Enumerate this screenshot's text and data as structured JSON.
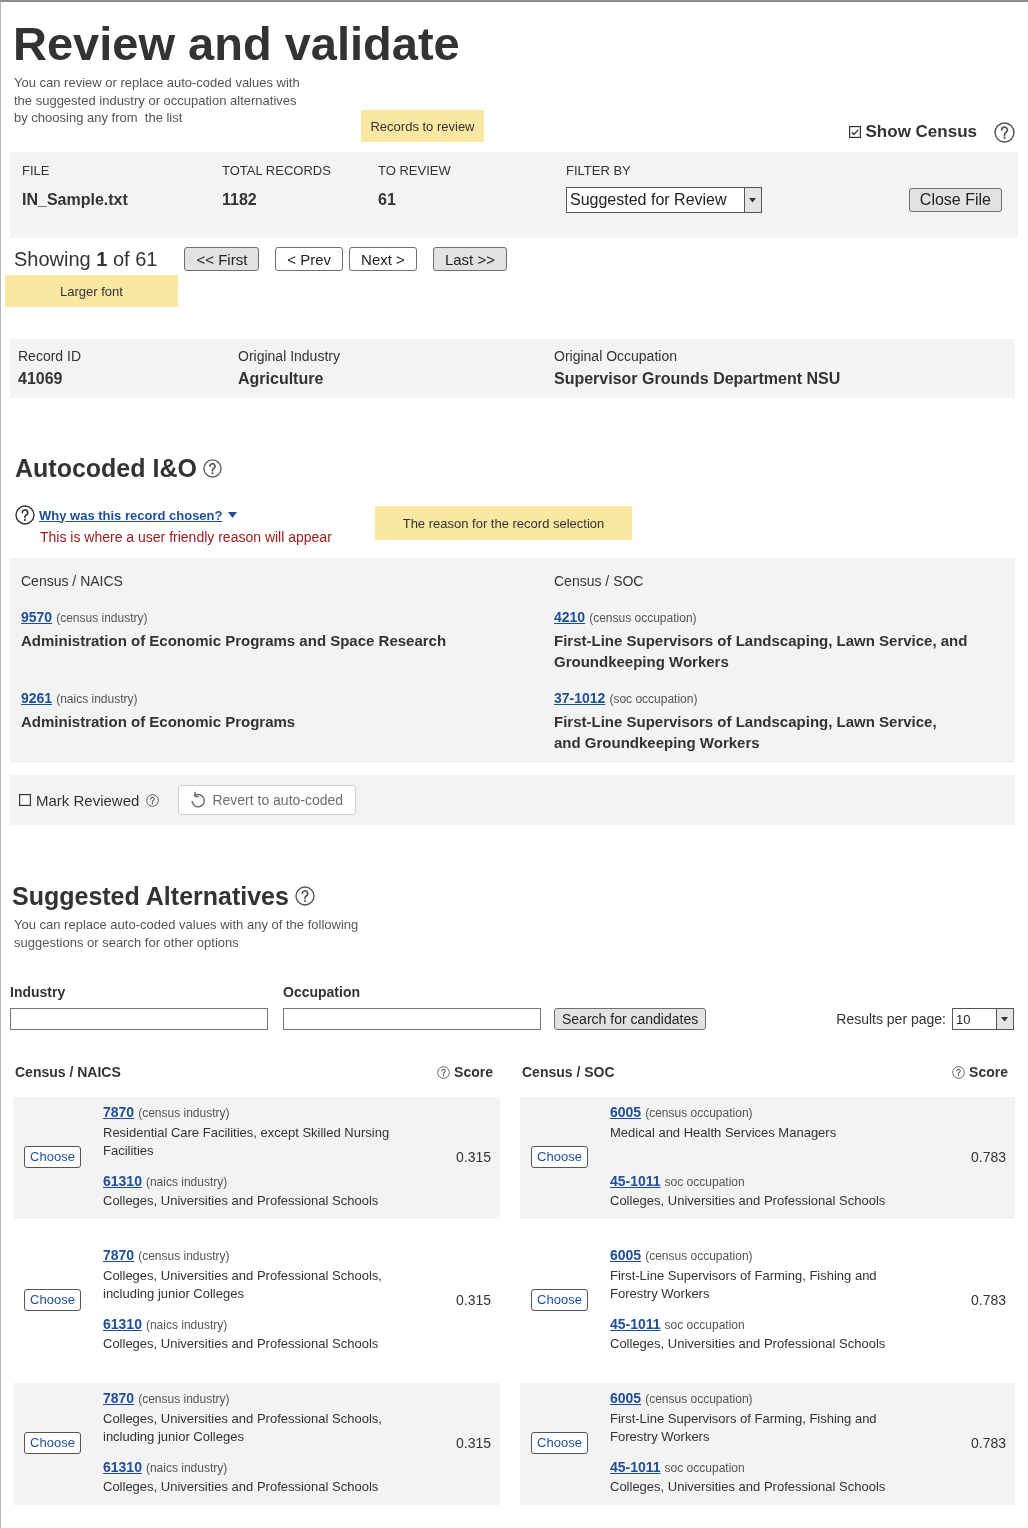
{
  "header": {
    "title": "Review and validate",
    "description": "You can review or replace auto-coded values with\nthe suggested industry or occupation alternatives\nby choosing any from  the list",
    "note": "Records to review",
    "show_census": {
      "label": "Show Census",
      "checked": true
    }
  },
  "file_panel": {
    "fields": [
      {
        "label": "FILE",
        "value": "IN_Sample.txt"
      },
      {
        "label": "TOTAL RECORDS",
        "value": "1182"
      },
      {
        "label": "TO REVIEW",
        "value": "61"
      }
    ],
    "filter": {
      "label": "FILTER BY",
      "value": "Suggested for Review"
    },
    "close_button": "Close File"
  },
  "pager": {
    "showing": "Showing **1** of 61",
    "buttons": [
      {
        "label": "<< First",
        "kind": "jump"
      },
      {
        "label": "< Prev",
        "kind": "step"
      },
      {
        "label": "Next >",
        "kind": "step"
      },
      {
        "label": "Last >>",
        "kind": "jump"
      }
    ],
    "note": "Larger font"
  },
  "record": {
    "fields": [
      {
        "label": "Record ID",
        "value": "41069"
      },
      {
        "label": "Original Industry",
        "value": "Agriculture"
      },
      {
        "label": "Original Occupation",
        "value": "Supervisor Grounds Department NSU"
      }
    ]
  },
  "autocoded": {
    "title": "Autocoded I&O",
    "reason_link": "Why was this record chosen?",
    "reason_text": "This is where a user friendly reason will appear",
    "note": "The reason for the record selection",
    "columns": [
      {
        "heading": "Census / NAICS",
        "entries": [
          {
            "code": "9570",
            "type": "(census industry)",
            "name": "Administration of Economic Programs and Space Research"
          },
          {
            "code": "9261",
            "type": "(naics industry)",
            "name": "Administration of Economic Programs"
          }
        ]
      },
      {
        "heading": "Census / SOC",
        "entries": [
          {
            "code": "4210",
            "type": "(census occupation)",
            "name": "First-Line Supervisors of Landscaping, Lawn Service, and\nGroundkeeping Workers"
          },
          {
            "code": "37-1012",
            "type": "(soc occupation)",
            "name": "First-Line Supervisors of Landscaping, Lawn Service,\nand Groundkeeping Workers"
          }
        ]
      }
    ],
    "mark_reviewed": {
      "label": "Mark Reviewed",
      "checked": false
    },
    "revert_button": {
      "label": "Revert to auto-coded",
      "disabled": true
    }
  },
  "alternatives": {
    "title": "Suggested Alternatives",
    "description": "You can replace auto-coded values with any of the following\nsuggestions or search for other options",
    "search": {
      "fields": [
        {
          "label": "Industry"
        },
        {
          "label": "Occupation"
        }
      ],
      "button": "Search for candidates",
      "results_label": "Results per page:",
      "results_value": "10"
    },
    "columns": [
      {
        "heading": "Census / NAICS",
        "score_label": "Score"
      },
      {
        "heading": "Census / SOC",
        "score_label": "Score"
      }
    ],
    "rows": [
      {
        "industry": {
          "button": "Choose",
          "entries": [
            {
              "code": "7870",
              "type": "(census industry)",
              "name": "Residential Care Facilities, except Skilled Nursing Facilities"
            },
            {
              "code": "61310",
              "type": "(naics industry)",
              "name": "Colleges, Universities and Professional Schools"
            }
          ],
          "score": "0.315"
        },
        "occupation": {
          "button": "Choose",
          "entries": [
            {
              "code": "6005",
              "type": "(census occupation)",
              "name": "Medical and Health Services Managers"
            },
            {
              "code": "45-1011",
              "type": "soc occupation",
              "name": "Colleges, Universities and Professional Schools"
            }
          ],
          "score": "0.783"
        }
      },
      {
        "industry": {
          "button": "Choose",
          "entries": [
            {
              "code": "7870",
              "type": "(census industry)",
              "name": "Colleges, Universities and Professional Schools, including junior Colleges"
            },
            {
              "code": "61310",
              "type": "(naics industry)",
              "name": "Colleges, Universities and Professional Schools"
            }
          ],
          "score": "0.315"
        },
        "occupation": {
          "button": "Choose",
          "entries": [
            {
              "code": "6005",
              "type": "(census occupation)",
              "name": "First-Line Supervisors of Farming, Fishing and Forestry Workers"
            },
            {
              "code": "45-1011",
              "type": "soc occupation",
              "name": "Colleges, Universities and Professional Schools"
            }
          ],
          "score": "0.783"
        }
      },
      {
        "industry": {
          "button": "Choose",
          "entries": [
            {
              "code": "7870",
              "type": "(census industry)",
              "name": "Colleges, Universities and Professional Schools, including junior Colleges"
            },
            {
              "code": "61310",
              "type": "(naics industry)",
              "name": "Colleges, Universities and Professional Schools"
            }
          ],
          "score": "0.315"
        },
        "occupation": {
          "button": "Choose",
          "entries": [
            {
              "code": "6005",
              "type": "(census occupation)",
              "name": "First-Line Supervisors of Farming, Fishing and Forestry Workers"
            },
            {
              "code": "45-1011",
              "type": "soc occupation",
              "name": "Colleges, Universities and Professional Schools"
            }
          ],
          "score": "0.783"
        }
      }
    ]
  }
}
